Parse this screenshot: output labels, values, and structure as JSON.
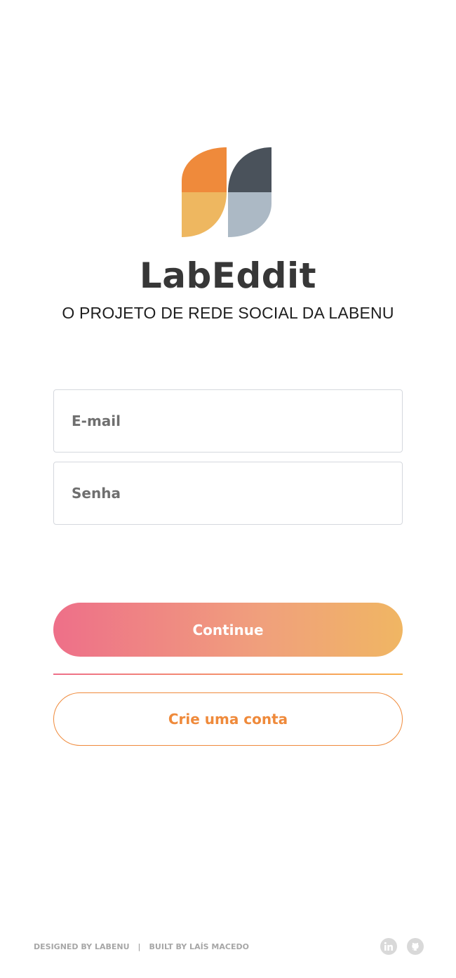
{
  "brand": {
    "name": "LabEddit",
    "tagline": "O PROJETO DE REDE SOCIAL DA LABENU",
    "logo_colors": {
      "orange": "#ef8a3b",
      "light_orange": "#eeb760",
      "dark_slate": "#4a525b",
      "light_slate": "#acb9c5"
    }
  },
  "form": {
    "email_placeholder": "E-mail",
    "password_placeholder": "Senha"
  },
  "actions": {
    "continue_label": "Continue",
    "create_account_label": "Crie uma conta"
  },
  "footer": {
    "designed_by": "DESIGNED BY LABENU",
    "separator": "|",
    "built_by": "BUILT BY LAÍS MACEDO",
    "icons": [
      "linkedin-icon",
      "github-icon"
    ]
  },
  "colors": {
    "gradient_start": "#ee6f89",
    "gradient_end": "#f0b663",
    "accent": "#ef8a3b"
  }
}
